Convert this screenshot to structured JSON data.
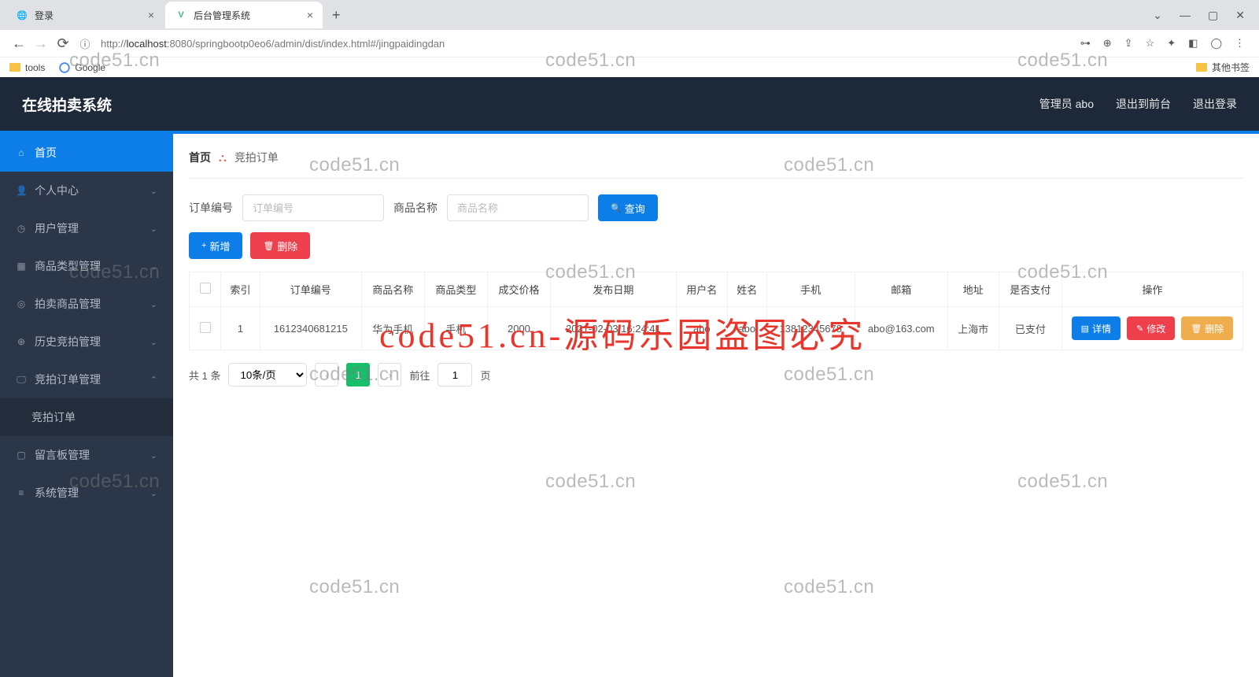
{
  "browser": {
    "tabs": [
      {
        "title": "登录",
        "favicon": "generic"
      },
      {
        "title": "后台管理系统",
        "favicon": "vue"
      }
    ],
    "url_scheme": "http://",
    "url_domain": "localhost",
    "url_path": ":8080/springbootp0eo6/admin/dist/index.html#/jingpaidingdan",
    "bookmarks": {
      "tools": "tools",
      "google": "Google",
      "other": "其他书签"
    },
    "window": {
      "min": "—",
      "max": "▢",
      "close": "✕",
      "drop": "⌄"
    }
  },
  "header": {
    "title": "在线拍卖系统",
    "admin": "管理员 abo",
    "toFront": "退出到前台",
    "logout": "退出登录"
  },
  "sidebar": [
    {
      "label": "首页",
      "icon": "home",
      "active": true,
      "expandable": false
    },
    {
      "label": "个人中心",
      "icon": "user",
      "expandable": true
    },
    {
      "label": "用户管理",
      "icon": "clock",
      "expandable": true
    },
    {
      "label": "商品类型管理",
      "icon": "grid",
      "expandable": true
    },
    {
      "label": "拍卖商品管理",
      "icon": "target",
      "expandable": true
    },
    {
      "label": "历史竞拍管理",
      "icon": "plus-circle",
      "expandable": true
    },
    {
      "label": "竞拍订单管理",
      "icon": "monitor",
      "expandable": true,
      "expanded": true,
      "children": [
        {
          "label": "竞拍订单"
        }
      ]
    },
    {
      "label": "留言板管理",
      "icon": "square",
      "expandable": true
    },
    {
      "label": "系统管理",
      "icon": "sliders",
      "expandable": true
    }
  ],
  "breadcrumb": {
    "home": "首页",
    "current": "竞拍订单"
  },
  "filters": {
    "orderLabel": "订单编号",
    "orderPlaceholder": "订单编号",
    "productLabel": "商品名称",
    "productPlaceholder": "商品名称",
    "search": "查询"
  },
  "actions": {
    "add": "新增",
    "delete": "删除"
  },
  "table": {
    "columns": [
      "索引",
      "订单编号",
      "商品名称",
      "商品类型",
      "成交价格",
      "发布日期",
      "用户名",
      "姓名",
      "手机",
      "邮箱",
      "地址",
      "是否支付",
      "操作"
    ],
    "rows": [
      {
        "index": "1",
        "orderNo": "1612340681215",
        "product": "华为手机",
        "type": "手机",
        "price": "2000",
        "date": "2021-02-03 16:24:41",
        "user": "abo",
        "name": "abo",
        "phone": "13812345678",
        "email": "abo@163.com",
        "address": "上海市",
        "paid": "已支付"
      }
    ],
    "ops": {
      "detail": "详情",
      "edit": "修改",
      "del": "删除"
    }
  },
  "pager": {
    "total": "共 1 条",
    "perPage": "10条/页",
    "page": "1",
    "goto": "前往",
    "goVal": "1",
    "pageSuffix": "页"
  },
  "watermark": "code51.cn",
  "watermark_red": "code51.cn-源码乐园盗图必究"
}
